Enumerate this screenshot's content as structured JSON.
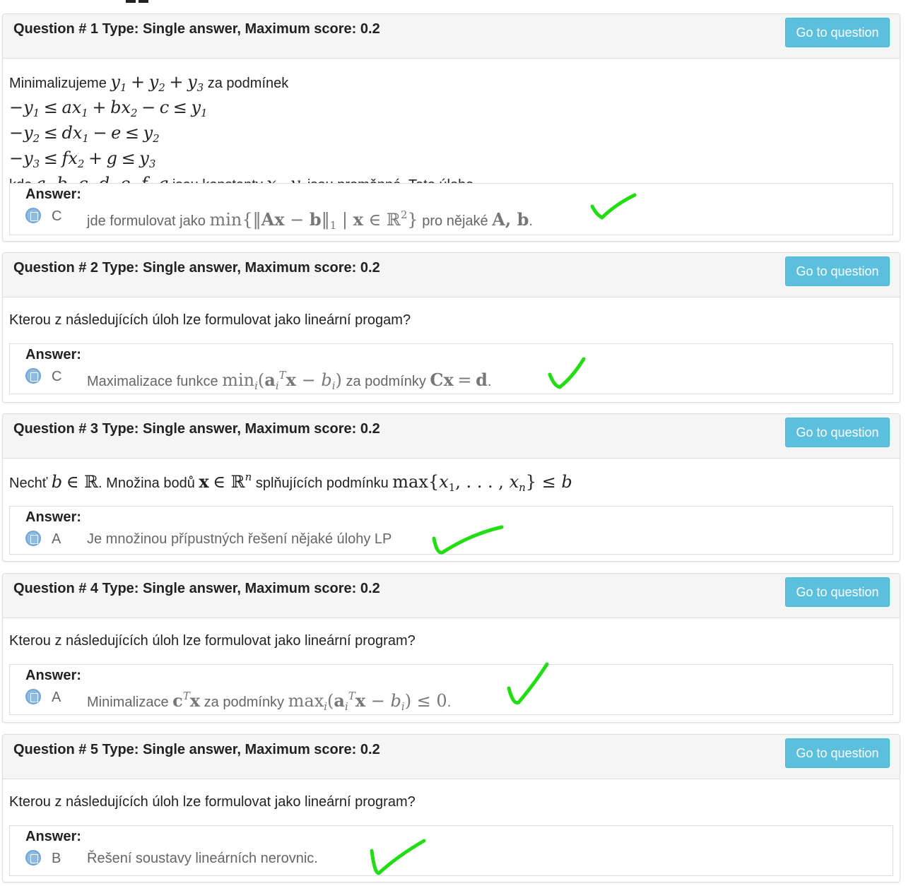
{
  "colors": {
    "check": "#22dd11",
    "button": "#5bc0de",
    "heading_bg": "#f5f5f5"
  },
  "goto_label": "Go to question",
  "answer_label": "Answer:",
  "questions": [
    {
      "title": "Question # 1 Type: Single answer, Maximum score: 0.2",
      "text_intro": "Minimalizujeme",
      "text_after_sum": "za podmínek",
      "text_kde": "kde",
      "text_konst": "jsou konstanty",
      "text_end": "jsou proměnné. Tato úloha",
      "answer_letter": "C",
      "answer_pre": "jde formulovat jako",
      "answer_post": "pro nějaké"
    },
    {
      "title": "Question # 2 Type: Single answer, Maximum score: 0.2",
      "text": "Kterou z následujících úloh lze formulovat jako lineární progam?",
      "answer_letter": "C",
      "answer_pre": "Maximalizace funkce",
      "answer_mid": "za podmínky"
    },
    {
      "title": "Question # 3 Type: Single answer, Maximum score: 0.2",
      "text_pre": "Nechť",
      "text_mid": "Množina bodů",
      "text_post": "splňujících podmínku",
      "answer_letter": "A",
      "answer_text": "Je množinou přípustných řešení nějaké úlohy LP"
    },
    {
      "title": "Question # 4 Type: Single answer, Maximum score: 0.2",
      "text": "Kterou z následujících úloh lze formulovat jako lineární program?",
      "answer_letter": "A",
      "answer_pre": "Minimalizace",
      "answer_mid": "za podmínky"
    },
    {
      "title": "Question # 5 Type: Single answer, Maximum score: 0.2",
      "text": "Kterou z následujících úloh lze formulovat jako lineární program?",
      "answer_letter": "B",
      "answer_text": "Řešení soustavy lineárních nerovnic."
    }
  ]
}
